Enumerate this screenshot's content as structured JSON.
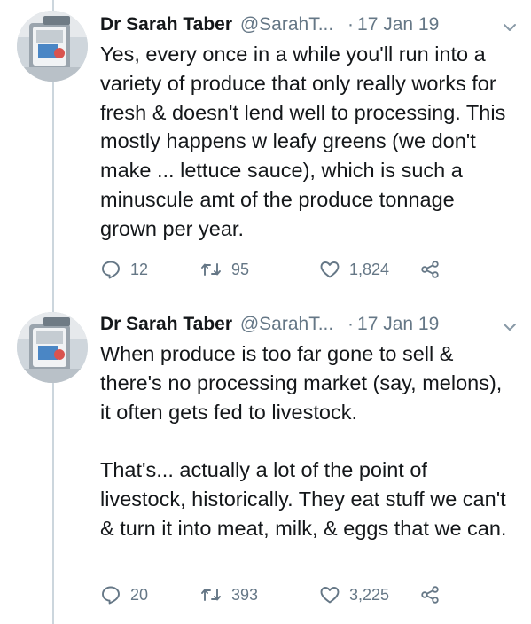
{
  "tweets": [
    {
      "author_name": "Dr Sarah Taber",
      "handle": "@SarahT...",
      "separator": "·",
      "date": "17 Jan 19",
      "paragraphs": [
        "Yes, every once in a while you'll run into a variety of produce that only really works for fresh & doesn't lend well to processing. This mostly happens w leafy greens (we don't make ... lettuce sauce), which is such a minuscule amt of the produce tonnage grown per year."
      ],
      "replies": "12",
      "retweets": "95",
      "likes": "1,824"
    },
    {
      "author_name": "Dr Sarah Taber",
      "handle": "@SarahT...",
      "separator": "·",
      "date": "17 Jan 19",
      "paragraphs": [
        "When produce is too far gone to sell & there's no processing market (say, melons), it often gets fed to livestock.",
        "That's... actually a lot of the point of livestock, historically. They eat stuff we can't & turn it into meat, milk, & eggs that we can."
      ],
      "replies": "20",
      "retweets": "393",
      "likes": "3,225"
    }
  ],
  "icons": {
    "reply": "reply-icon",
    "retweet": "retweet-icon",
    "like": "heart-icon",
    "share": "share-icon",
    "more": "chevron-down-icon"
  },
  "colors": {
    "text": "#14171a",
    "secondary": "#657786",
    "thread_line": "#ccd6dd"
  }
}
